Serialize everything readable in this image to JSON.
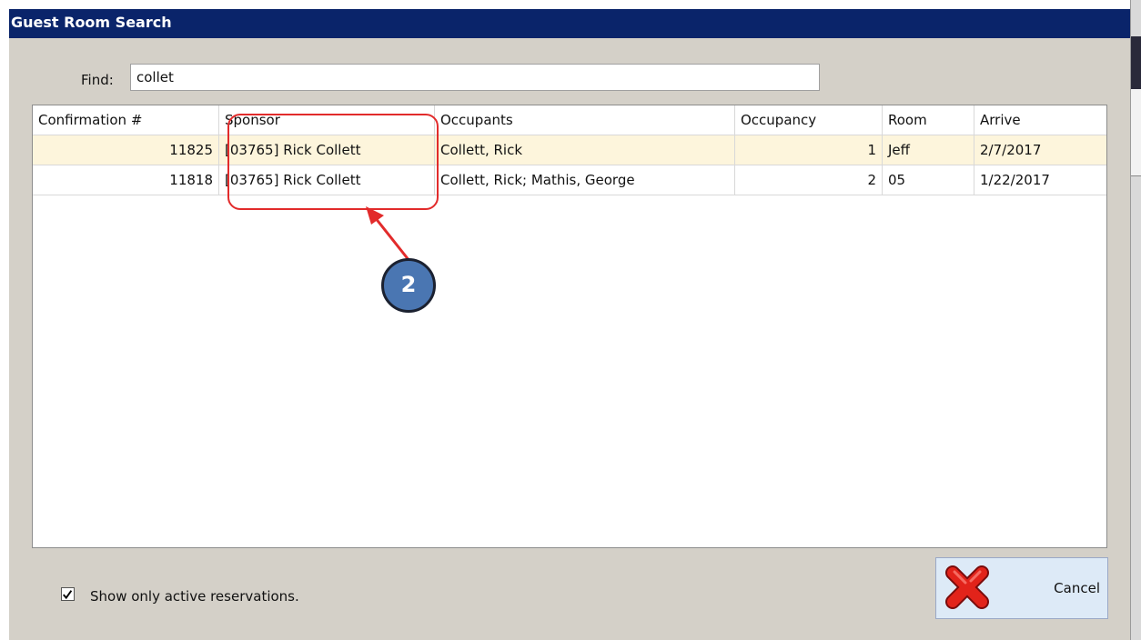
{
  "window": {
    "title": "Guest Room Search"
  },
  "find": {
    "label": "Find:",
    "value": "collet"
  },
  "grid": {
    "columns": [
      "Confirmation #",
      "Sponsor",
      "Occupants",
      "Occupancy",
      "Room",
      "Arrive"
    ],
    "rows": [
      {
        "confirmation": "11825",
        "sponsor": "[03765] Rick Collett",
        "occupants": "Collett, Rick",
        "occupancy": "1",
        "room": "Jeff",
        "arrive": "2/7/2017"
      },
      {
        "confirmation": "11818",
        "sponsor": "[03765] Rick Collett",
        "occupants": "Collett, Rick; Mathis, George",
        "occupancy": "2",
        "room": "05",
        "arrive": "1/22/2017"
      }
    ]
  },
  "annotation": {
    "step": "2",
    "color": "#e22b2b",
    "badge_color": "#4a76b2"
  },
  "options": {
    "active_only_label": "Show only active reservations.",
    "active_only_checked": true
  },
  "cancel": {
    "label": "Cancel",
    "icon": "red-x-icon"
  },
  "colors": {
    "titlebar": "#0a246a",
    "selected_row": "#fdf5dc",
    "dialog_bg": "#d4d0c8"
  }
}
